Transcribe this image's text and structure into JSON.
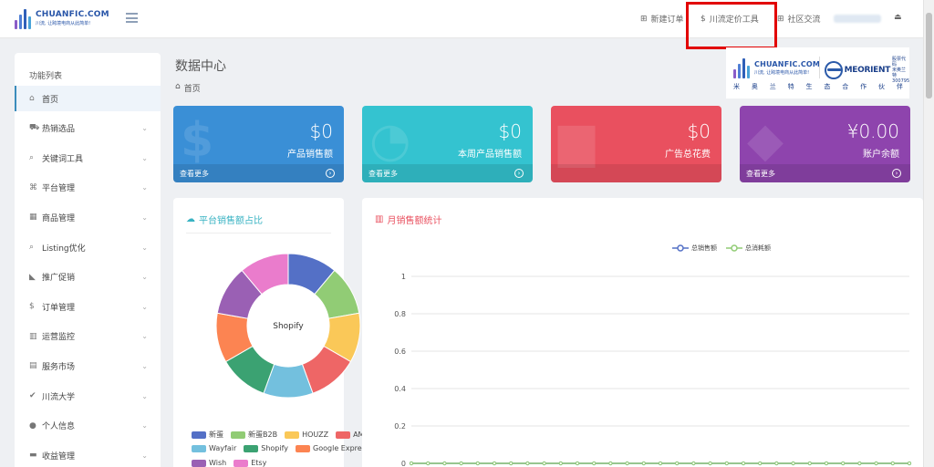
{
  "header": {
    "logo_name": "CHUANFIC.COM",
    "logo_slogan": "川流, 让跨境电商从此简单!",
    "nav": [
      {
        "label": "新建订单",
        "icon": "plus-square-icon"
      },
      {
        "label": "川流定价工具",
        "icon": "dollar-icon"
      },
      {
        "label": "社区交流",
        "icon": "plus-square-icon"
      }
    ]
  },
  "sidebar": {
    "title": "功能列表",
    "items": [
      {
        "label": "首页",
        "icon": "home-icon",
        "icon_glyph": "⌂",
        "active": true
      },
      {
        "label": "热销选品",
        "icon": "cart-icon",
        "icon_glyph": "⛟"
      },
      {
        "label": "关键词工具",
        "icon": "search-icon",
        "icon_glyph": "⌕"
      },
      {
        "label": "平台管理",
        "icon": "sitemap-icon",
        "icon_glyph": "⌘"
      },
      {
        "label": "商品管理",
        "icon": "grid-icon",
        "icon_glyph": "▦"
      },
      {
        "label": "Listing优化",
        "icon": "search-icon",
        "icon_glyph": "⌕"
      },
      {
        "label": "推广促销",
        "icon": "bullhorn-icon",
        "icon_glyph": "◣"
      },
      {
        "label": "订单管理",
        "icon": "dollar-icon",
        "icon_glyph": "$"
      },
      {
        "label": "运营监控",
        "icon": "bar-chart-icon",
        "icon_glyph": "▥"
      },
      {
        "label": "服务市场",
        "icon": "map-icon",
        "icon_glyph": "▤"
      },
      {
        "label": "川流大学",
        "icon": "check-circle-icon",
        "icon_glyph": "✔"
      },
      {
        "label": "个人信息",
        "icon": "user-icon",
        "icon_glyph": "●"
      },
      {
        "label": "收益管理",
        "icon": "credit-card-icon",
        "icon_glyph": "▬"
      }
    ]
  },
  "main": {
    "title": "数据中心",
    "breadcrumb": "首页"
  },
  "partner": {
    "left_name": "CHUANFIC.COM",
    "left_slogan": "川流, 让跨境电商从此简单!",
    "right_name": "MEORIENT",
    "right_code_top": "股票代码",
    "right_code_mid": "米奥兰特",
    "right_code": "300795",
    "slogan": [
      "米",
      "奥",
      "兰",
      "特",
      "生",
      "态",
      "合",
      "作",
      "伙",
      "伴"
    ]
  },
  "stats": [
    {
      "value": "$0",
      "label": "产品销售额",
      "more": "查看更多",
      "color": "#3a8fd6"
    },
    {
      "value": "$0",
      "label": "本周产品销售额",
      "more": "查看更多",
      "color": "#34c3d0"
    },
    {
      "value": "$0",
      "label": "广告总花费",
      "more": "",
      "color": "#e9505f"
    },
    {
      "value": "¥0.00",
      "label": "账户余额",
      "more": "查看更多",
      "color": "#8e44ad"
    }
  ],
  "pie_panel": {
    "title": "平台销售额占比",
    "center_label": "Shopify",
    "color": "#39b3c3"
  },
  "line_panel": {
    "title": "月销售额统计",
    "color": "#e9505f"
  },
  "chart_data": [
    {
      "type": "pie",
      "title": "平台销售额占比",
      "categories": [
        "新蛋",
        "新蛋B2B",
        "HOUZZ",
        "AM",
        "Wayfair",
        "Shopify",
        "Google Express",
        "Wish",
        "Etsy"
      ],
      "colors": [
        "#5470c6",
        "#91cc75",
        "#fac858",
        "#ee6666",
        "#73c0de",
        "#3ba272",
        "#fc8452",
        "#9a60b4",
        "#ea7ccc"
      ],
      "values": [
        1,
        1,
        1,
        1,
        1,
        1,
        1,
        1,
        1
      ],
      "legend_position": "bottom"
    },
    {
      "type": "line",
      "title": "月销售额统计",
      "series": [
        {
          "name": "总销售额",
          "color": "#5470c6",
          "values": [
            0,
            0,
            0,
            0,
            0,
            0,
            0,
            0,
            0,
            0,
            0,
            0,
            0,
            0,
            0,
            0,
            0,
            0,
            0,
            0,
            0,
            0,
            0,
            0,
            0,
            0,
            0,
            0,
            0,
            0,
            0
          ]
        },
        {
          "name": "总消耗额",
          "color": "#91cc75",
          "values": [
            0,
            0,
            0,
            0,
            0,
            0,
            0,
            0,
            0,
            0,
            0,
            0,
            0,
            0,
            0,
            0,
            0,
            0,
            0,
            0,
            0,
            0,
            0,
            0,
            0,
            0,
            0,
            0,
            0,
            0,
            0
          ]
        }
      ],
      "ylim": [
        0,
        1
      ],
      "yticks": [
        "0",
        "0.2",
        "0.4",
        "0.6",
        "0.8",
        "1"
      ],
      "grid": true,
      "legend_position": "top"
    }
  ]
}
